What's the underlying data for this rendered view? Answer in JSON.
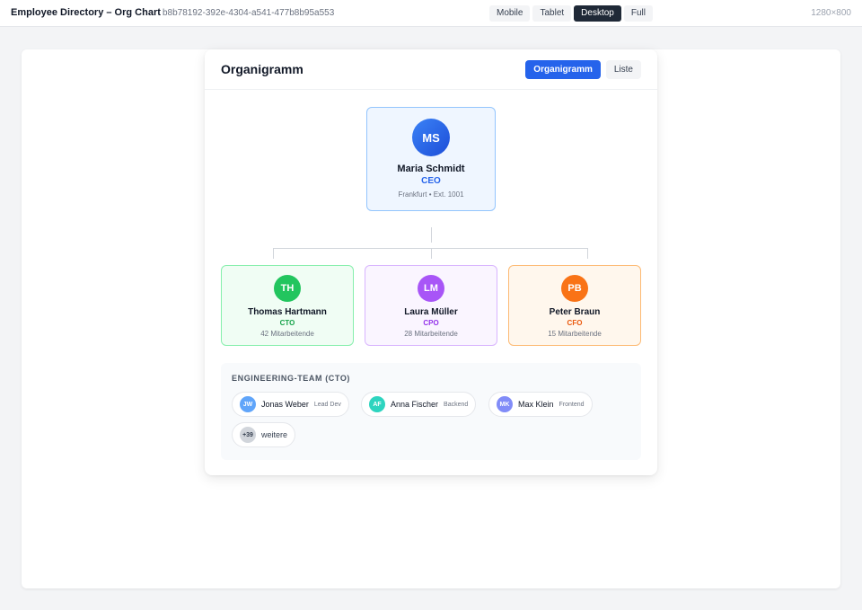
{
  "app": {
    "title": "Employee Directory – Org Chart",
    "id": "b8b78192-392e-4304-a541-477b8b95a553",
    "viewports": [
      "Mobile",
      "Tablet",
      "Desktop",
      "Full"
    ],
    "active_viewport": "Desktop",
    "viewport_size": "1280×800"
  },
  "panel": {
    "title": "Organigramm",
    "toggle": [
      "Organigramm",
      "Liste"
    ],
    "active_toggle": "Organigramm"
  },
  "ceo": {
    "initials": "MS",
    "name": "Maria Schmidt",
    "role": "CEO",
    "meta": "Frankfurt • Ext. 1001",
    "accent": "#2563eb"
  },
  "reports": [
    {
      "initials": "TH",
      "name": "Thomas Hartmann",
      "role": "CTO",
      "meta": "42 Mitarbeitende",
      "accent": "#16a34a",
      "avatar_color": "#22c55e"
    },
    {
      "initials": "LM",
      "name": "Laura Müller",
      "role": "CPO",
      "meta": "28 Mitarbeitende",
      "accent": "#9333ea",
      "avatar_color": "#a855f7"
    },
    {
      "initials": "PB",
      "name": "Peter Braun",
      "role": "CFO",
      "meta": "15 Mitarbeitende",
      "accent": "#ea580c",
      "avatar_color": "#f97316"
    }
  ],
  "team": {
    "title": "ENGINEERING-TEAM (CTO)",
    "members": [
      {
        "initials": "JW",
        "name": "Jonas Weber",
        "role": "Lead Dev",
        "avatar_color": "#60a5fa"
      },
      {
        "initials": "AF",
        "name": "Anna Fischer",
        "role": "Backend",
        "avatar_color": "#2dd4bf"
      },
      {
        "initials": "MK",
        "name": "Max Klein",
        "role": "Frontend",
        "avatar_color": "#818cf8"
      }
    ],
    "more": {
      "count": "+39",
      "label": "weitere"
    }
  }
}
